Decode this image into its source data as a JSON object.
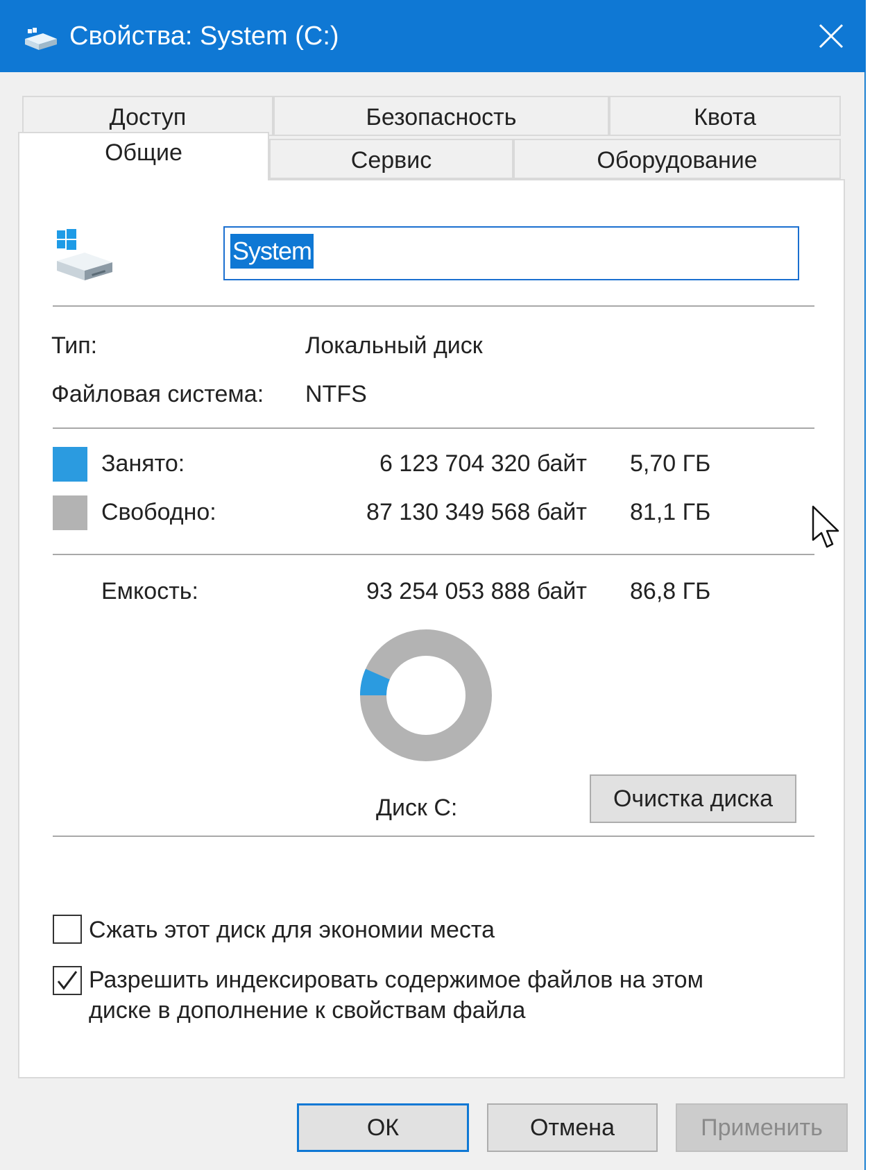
{
  "window": {
    "title": "Свойства: System (C:)"
  },
  "tabs": {
    "row1": [
      "Доступ",
      "Безопасность",
      "Квота"
    ],
    "row2": [
      "Общие",
      "Сервис",
      "Оборудование"
    ],
    "active": "Общие"
  },
  "general": {
    "volume_name": "System",
    "type_label": "Тип:",
    "type_value": "Локальный диск",
    "fs_label": "Файловая система:",
    "fs_value": "NTFS",
    "used_label": "Занято:",
    "used_bytes": "6 123 704 320 байт",
    "used_gb": "5,70 ГБ",
    "free_label": "Свободно:",
    "free_bytes": "87 130 349 568 байт",
    "free_gb": "81,1 ГБ",
    "capacity_label": "Емкость:",
    "capacity_bytes": "93 254 053 888 байт",
    "capacity_gb": "86,8 ГБ",
    "disk_label": "Диск С:",
    "cleanup_button": "Очистка диска",
    "used_color": "#2b9be0",
    "free_color": "#b3b3b3",
    "used_fraction": 0.0657
  },
  "options": {
    "compress_label": "Сжать этот диск для экономии места",
    "compress_checked": false,
    "index_label_line1": "Разрешить индексировать содержимое файлов на этом",
    "index_label_line2": "диске в дополнение к свойствам файла",
    "index_checked": true
  },
  "buttons": {
    "ok": "ОК",
    "cancel": "Отмена",
    "apply": "Применить"
  }
}
